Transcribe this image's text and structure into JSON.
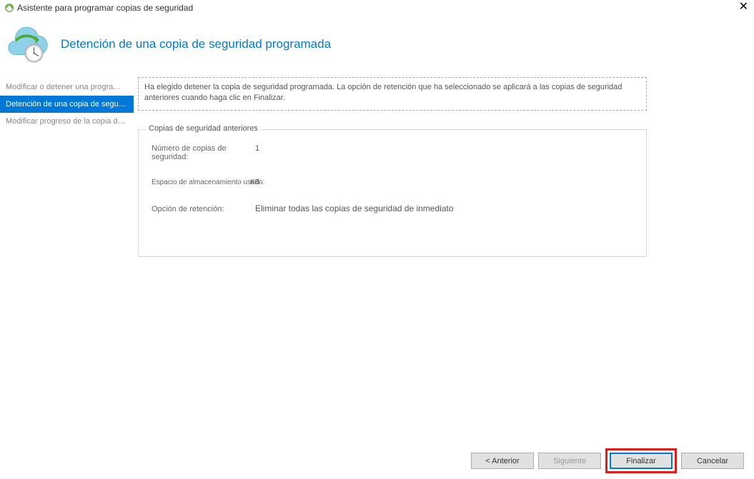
{
  "window": {
    "title": "Asistente para programar copias de seguridad"
  },
  "header": {
    "title": "Detención de una copia de seguridad programada"
  },
  "sidebar": {
    "items": [
      {
        "label": "Modificar o detener una progra..."
      },
      {
        "label": "Detención de una copia de seguridad"
      },
      {
        "label": "Modificar progreso de la copia de seguridad"
      }
    ]
  },
  "content": {
    "info_text": "Ha elegido detener la copia de seguridad programada. La opción de retención que ha seleccionado se aplicará a las copias de seguridad anteriores cuando haga clic en Finalizar.",
    "fieldset_legend": "Copias de seguridad anteriores",
    "backup_count_label": "Número de copias de seguridad:",
    "backup_count_value": "1",
    "storage_label": "Espacio de almacenamiento usado:",
    "storage_value": "KB",
    "retention_label": "Opción de retención:",
    "retention_value": "Eliminar todas las copias de seguridad de inmediato"
  },
  "buttons": {
    "previous": "<  Anterior",
    "next": "Siguiente",
    "finish": "Finalizar",
    "cancel": "Cancelar"
  }
}
